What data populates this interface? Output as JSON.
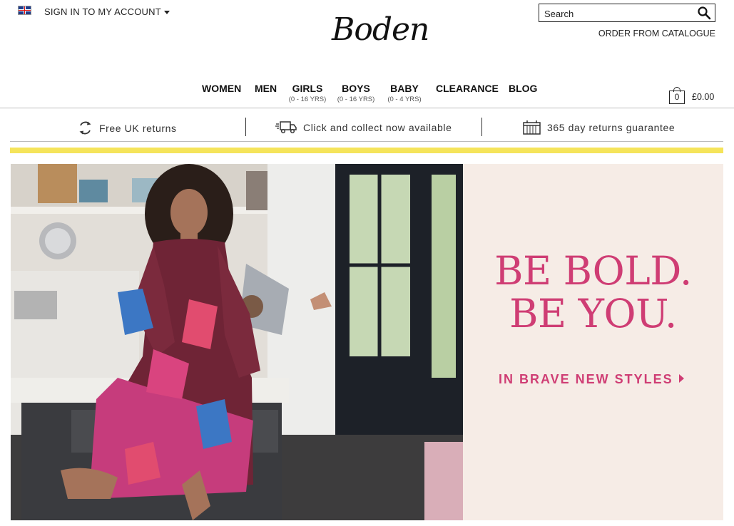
{
  "header": {
    "flag_icon": "uk-flag-icon",
    "sign_in": "SIGN IN TO MY ACCOUNT",
    "logo": "Boden",
    "search_placeholder": "Search",
    "order_catalogue": "ORDER FROM CATALOGUE",
    "basket_count": "0",
    "basket_total": "£0.00"
  },
  "nav": [
    {
      "label": "WOMEN",
      "sub": ""
    },
    {
      "label": "MEN",
      "sub": ""
    },
    {
      "label": "GIRLS",
      "sub": "(0 - 16 YRS)"
    },
    {
      "label": "BOYS",
      "sub": "(0 - 16 YRS)"
    },
    {
      "label": "BABY",
      "sub": "(0 - 4 YRS)"
    },
    {
      "label": "CLEARANCE",
      "sub": ""
    },
    {
      "label": "BLOG",
      "sub": ""
    }
  ],
  "usp": [
    {
      "icon": "returns-cycle-icon",
      "text": "Free UK returns"
    },
    {
      "icon": "delivery-van-icon",
      "text": "Click and collect now available"
    },
    {
      "icon": "calendar-icon",
      "text": "365 day returns guarantee"
    }
  ],
  "hero": {
    "headline_line1": "BE BOLD.",
    "headline_line2": "BE YOU.",
    "cta": "IN BRAVE NEW STYLES"
  },
  "colors": {
    "accent_pink": "#cf3d74",
    "promo_bg": "#f6ece6",
    "yellow_bar": "#f5e45a"
  }
}
